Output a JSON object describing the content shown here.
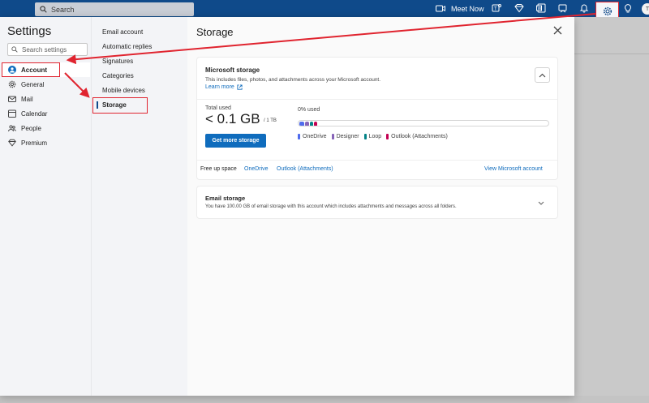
{
  "topbar": {
    "search_placeholder": "Search",
    "meet_now_label": "Meet Now",
    "avatar_initial": "T"
  },
  "settings": {
    "title": "Settings",
    "search_placeholder": "Search settings",
    "nav": [
      {
        "label": "Account",
        "icon": "person-icon"
      },
      {
        "label": "General",
        "icon": "gear-icon"
      },
      {
        "label": "Mail",
        "icon": "mail-icon"
      },
      {
        "label": "Calendar",
        "icon": "calendar-icon"
      },
      {
        "label": "People",
        "icon": "people-icon"
      },
      {
        "label": "Premium",
        "icon": "diamond-icon"
      }
    ],
    "subnav": [
      {
        "label": "Email account"
      },
      {
        "label": "Automatic replies"
      },
      {
        "label": "Signatures"
      },
      {
        "label": "Categories"
      },
      {
        "label": "Mobile devices"
      },
      {
        "label": "Storage"
      }
    ]
  },
  "storage": {
    "title": "Storage",
    "microsoft": {
      "title": "Microsoft storage",
      "description": "This includes files, photos, and attachments across your Microsoft account.",
      "learn_more": "Learn more",
      "total_used_label": "Total used",
      "total_used_value": "< 0.1 GB",
      "capacity": "/ 1 TB",
      "get_more_label": "Get more storage",
      "percent_used": "0% used",
      "legend": [
        {
          "label": "OneDrive",
          "color": "#4f6bed"
        },
        {
          "label": "Designer",
          "color": "#8764b8"
        },
        {
          "label": "Loop",
          "color": "#038387"
        },
        {
          "label": "Outlook (Attachments)",
          "color": "#c30052"
        }
      ],
      "free_up_label": "Free up space",
      "free_up_links": [
        "OneDrive",
        "Outlook (Attachments)"
      ],
      "view_account_link": "View Microsoft account"
    },
    "email": {
      "title": "Email storage",
      "description": "You have 100.00 GB of email storage with this account which includes attachments and messages across all folders."
    }
  },
  "colors": {
    "topbar": "#0f4a8a",
    "accent": "#0f6cbd",
    "highlight": "#e0242f"
  }
}
